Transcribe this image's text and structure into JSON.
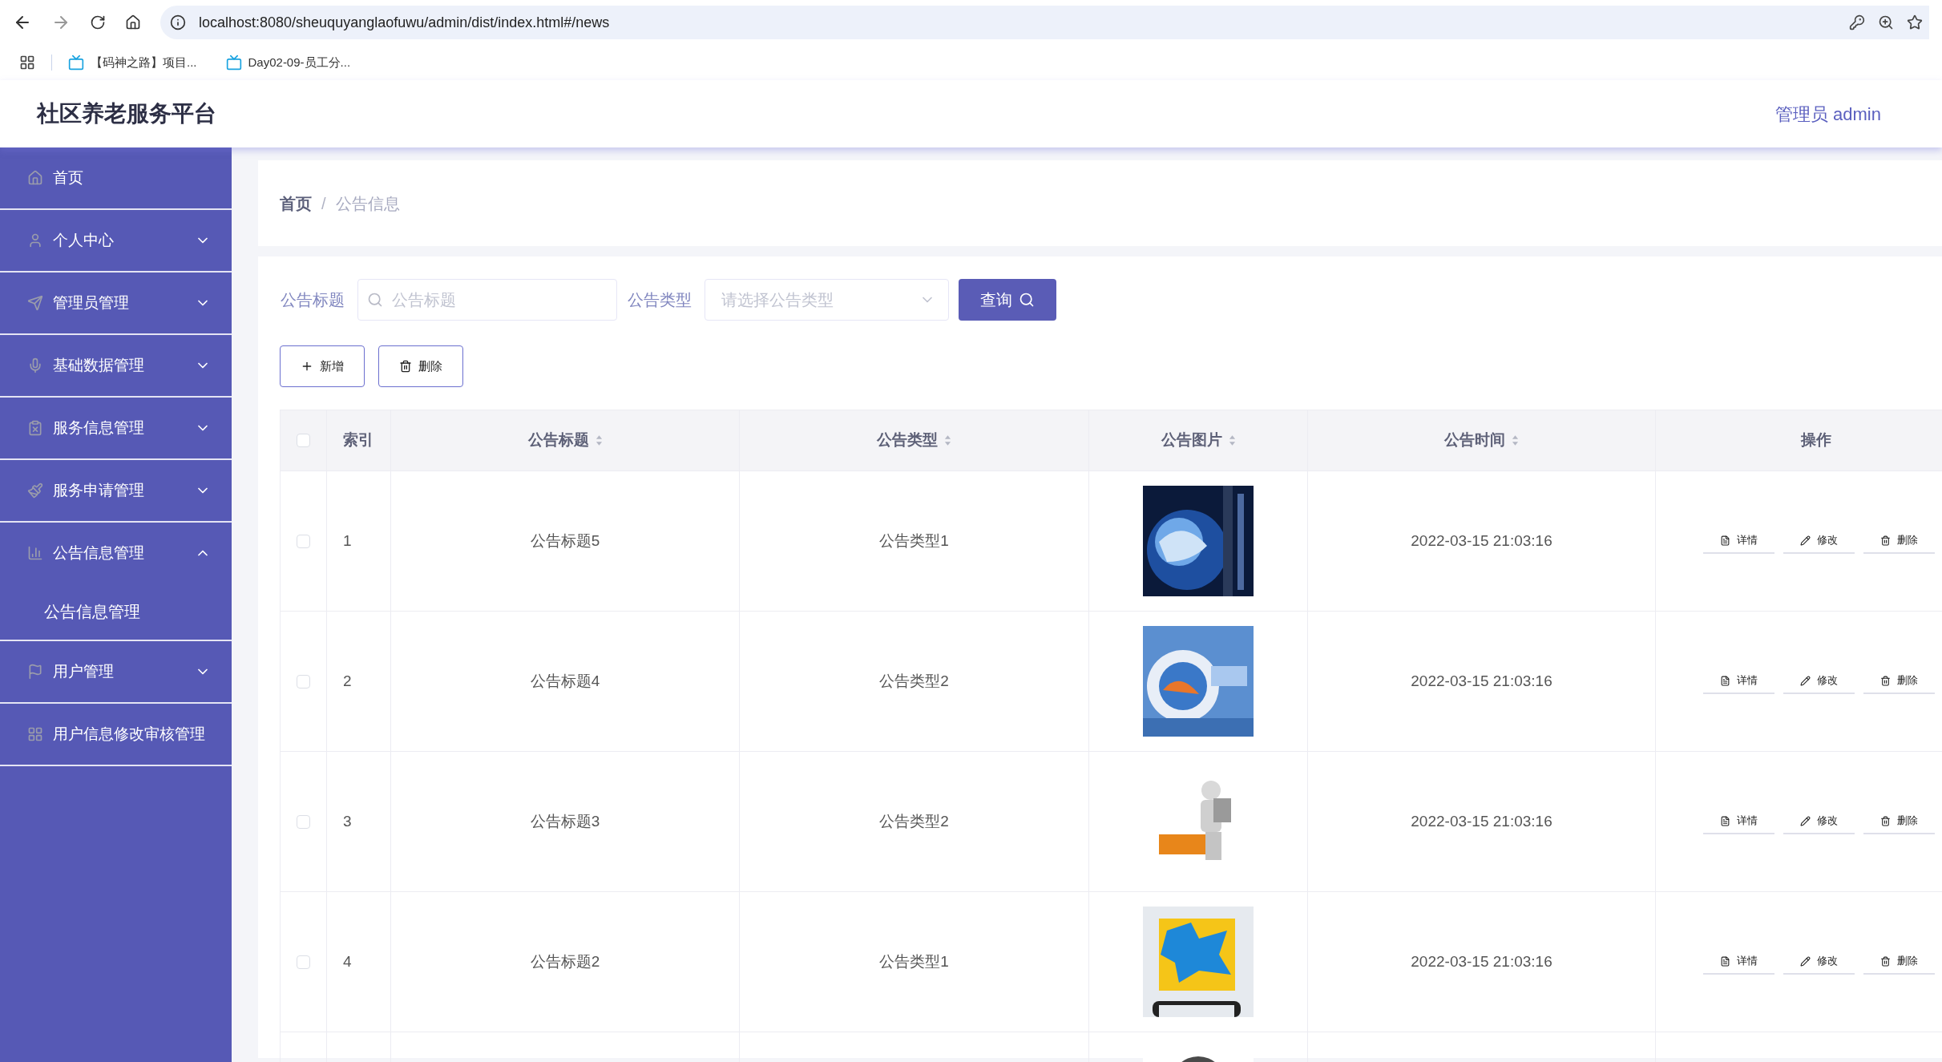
{
  "browser": {
    "url": "localhost:8080/sheuquyanglaofuwu/admin/dist/index.html#/news",
    "bookmarks": [
      "【码神之路】项目...",
      "Day02-09-员工分..."
    ]
  },
  "header": {
    "title": "社区养老服务平台",
    "user": "管理员 admin"
  },
  "sidebar": {
    "items": [
      {
        "label": "首页",
        "kind": "link"
      },
      {
        "label": "个人中心",
        "kind": "menu",
        "expanded": false
      },
      {
        "label": "管理员管理",
        "kind": "menu",
        "expanded": false
      },
      {
        "label": "基础数据管理",
        "kind": "menu",
        "expanded": false
      },
      {
        "label": "服务信息管理",
        "kind": "menu",
        "expanded": false
      },
      {
        "label": "服务申请管理",
        "kind": "menu",
        "expanded": false
      },
      {
        "label": "公告信息管理",
        "kind": "menu",
        "expanded": true,
        "children": [
          {
            "label": "公告信息管理"
          }
        ]
      },
      {
        "label": "用户管理",
        "kind": "menu",
        "expanded": false
      },
      {
        "label": "用户信息修改审核管理",
        "kind": "link"
      }
    ]
  },
  "breadcrumb": {
    "separator": "/",
    "items": [
      "首页",
      "公告信息"
    ]
  },
  "filters": [
    {
      "label": "公告标题",
      "kind": "text",
      "placeholder": "公告标题"
    },
    {
      "label": "公告类型",
      "kind": "select",
      "placeholder": "请选择公告类型"
    }
  ],
  "search_button": "查询",
  "actions": [
    {
      "label": "新增",
      "kind": "add"
    },
    {
      "label": "删除",
      "kind": "delete"
    }
  ],
  "table": {
    "all_checked": false,
    "columns": [
      {
        "label": "索引",
        "sortable": false
      },
      {
        "label": "公告标题",
        "sortable": true
      },
      {
        "label": "公告类型",
        "sortable": true
      },
      {
        "label": "公告图片",
        "sortable": true
      },
      {
        "label": "公告时间",
        "sortable": true
      },
      {
        "label": "操作",
        "sortable": false
      }
    ],
    "rows": [
      {
        "checked": false,
        "index": "1",
        "title": "公告标题5",
        "type": "公告类型1",
        "time": "2022-03-15 21:03:16",
        "actions": [
          "详情",
          "修改",
          "删除"
        ]
      },
      {
        "checked": false,
        "index": "2",
        "title": "公告标题4",
        "type": "公告类型2",
        "time": "2022-03-15 21:03:16",
        "actions": [
          "详情",
          "修改",
          "删除"
        ]
      },
      {
        "checked": false,
        "index": "3",
        "title": "公告标题3",
        "type": "公告类型2",
        "time": "2022-03-15 21:03:16",
        "actions": [
          "详情",
          "修改",
          "删除"
        ]
      },
      {
        "checked": false,
        "index": "4",
        "title": "公告标题2",
        "type": "公告类型1",
        "time": "2022-03-15 21:03:16",
        "actions": [
          "详情",
          "修改",
          "删除"
        ]
      }
    ]
  }
}
